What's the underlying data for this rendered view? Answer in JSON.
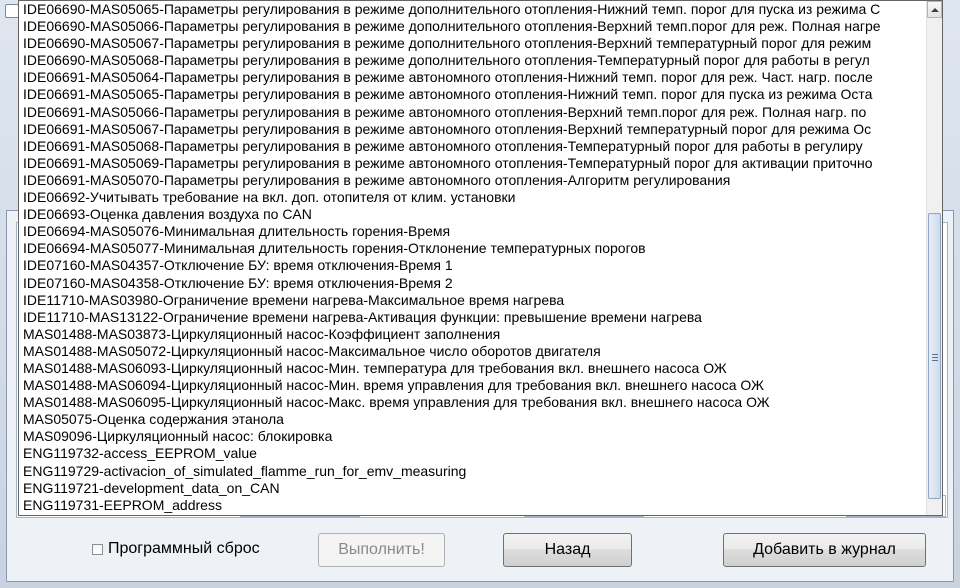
{
  "list_items": [
    "IDE06690-MAS05065-Параметры регулирования в режиме дополнительного отопления-Нижний темп. порог для пуска из режима С",
    "IDE06690-MAS05066-Параметры регулирования в режиме дополнительного отопления-Верхний темп.порог для реж. Полная нагре",
    "IDE06690-MAS05067-Параметры регулирования в режиме дополнительного отопления-Верхний температурный порог для режим",
    "IDE06690-MAS05068-Параметры регулирования в режиме дополнительного отопления-Температурный порог для работы в регул",
    "IDE06691-MAS05064-Параметры регулирования в режиме автономного отопления-Нижний темп. порог для реж. Част. нагр. после",
    "IDE06691-MAS05065-Параметры регулирования в режиме автономного отопления-Нижний темп. порог для пуска из режима Оста",
    "IDE06691-MAS05066-Параметры регулирования в режиме автономного отопления-Верхний темп.порог для реж. Полная нагр. по",
    "IDE06691-MAS05067-Параметры регулирования в режиме автономного отопления-Верхний температурный порог для режима Ос",
    "IDE06691-MAS05068-Параметры регулирования в режиме автономного отопления-Температурный порог для работы в регулиру",
    "IDE06691-MAS05069-Параметры регулирования в режиме автономного отопления-Температурный порог для активации приточно",
    "IDE06691-MAS05070-Параметры регулирования в режиме автономного отопления-Алгоритм регулирования",
    "IDE06692-Учитывать требование на вкл. доп. отопителя от клим. установки",
    "IDE06693-Оценка давления воздуха по CAN",
    "IDE06694-MAS05076-Минимальная длительность горения-Время",
    "IDE06694-MAS05077-Минимальная длительность горения-Отклонение температурных порогов",
    "IDE07160-MAS04357-Отключение БУ: время отключения-Время 1",
    "IDE07160-MAS04358-Отключение БУ: время отключения-Время 2",
    "IDE11710-MAS03980-Ограничение времени нагрева-Максимальное время нагрева",
    "IDE11710-MAS13122-Ограничение времени нагрева-Активация функции: превышение времени нагрева",
    "MAS01488-MAS03873-Циркуляционный насос-Коэффициент заполнения",
    "MAS01488-MAS05072-Циркуляционный насос-Максимальное число оборотов двигателя",
    "MAS01488-MAS06093-Циркуляционный насос-Мин. температура для требования вкл. внешнего насоса ОЖ",
    "MAS01488-MAS06094-Циркуляционный насос-Мин. время управления для требования вкл. внешнего насоса ОЖ",
    "MAS01488-MAS06095-Циркуляционный насос-Макс. время управления для требования вкл. внешнего насоса ОЖ",
    "MAS05075-Оценка содержания этанола",
    "MAS09096-Циркуляционный насос: блокировка",
    "ENG119732-access_EEPROM_value",
    "ENG119729-activacion_of_simulated_flamme_run_for_emv_measuring",
    "ENG119721-development_data_on_CAN",
    "ENG119731-EEPROM_address"
  ],
  "controls": {
    "checkbox_label": "Программный сброс",
    "checkbox_checked": false,
    "execute_button": "Выполнить!",
    "back_button": "Назад",
    "add_to_log_button": "Добавить в журнал"
  },
  "icons": {
    "scroll_up": "chevron-up-icon",
    "scroll_grip": "grip-icon"
  }
}
